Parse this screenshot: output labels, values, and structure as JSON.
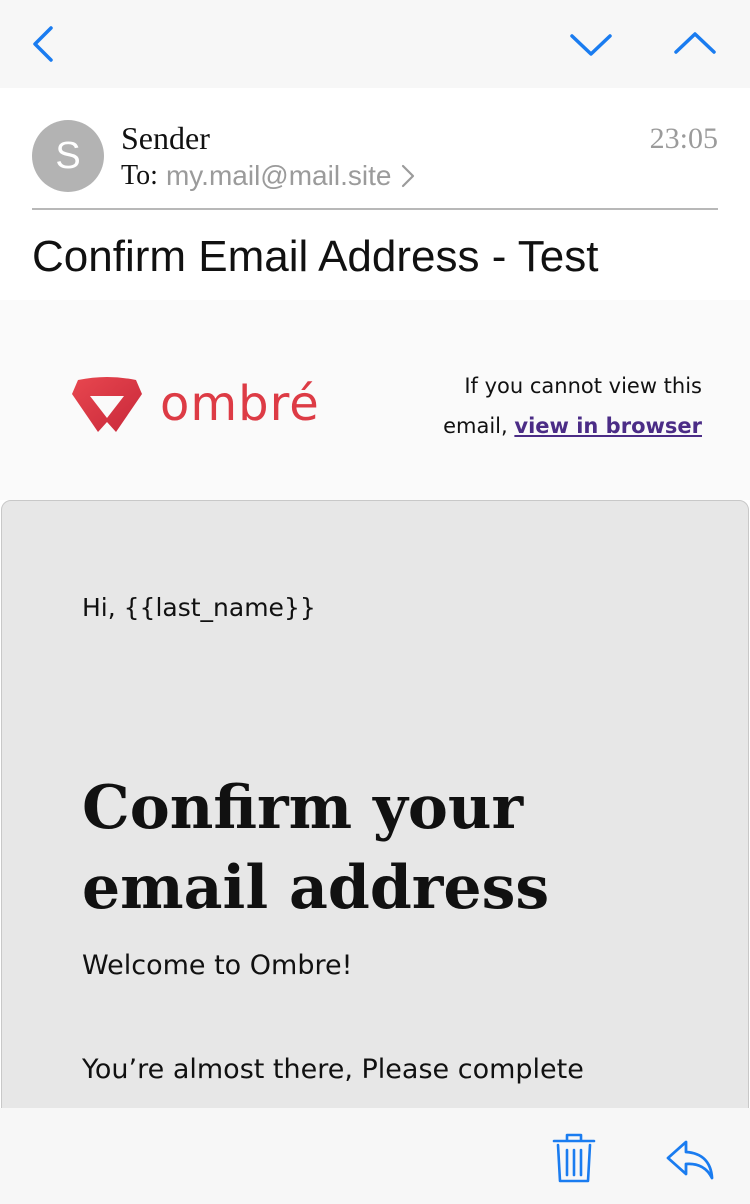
{
  "nav": {
    "back_icon": "chevron-left-icon",
    "down_icon": "chevron-down-icon",
    "up_icon": "chevron-up-icon",
    "accent_color": "#1a7cf0"
  },
  "message": {
    "avatar_initial": "S",
    "sender": "Sender",
    "to_label": "To:",
    "to_address": "my.mail@mail.site",
    "time": "23:05",
    "subject": "Confirm Email Address - Test"
  },
  "email": {
    "logo_text": "ombré",
    "brand_color": "#dd3b45",
    "view_note": "If you cannot view this email,",
    "view_link": "view in browser",
    "greeting": "Hi, {{last_name}}",
    "headline": "Confirm your email address",
    "welcome": "Welcome to Ombre!",
    "almost": "You’re almost there, Please complete"
  },
  "toolbar": {
    "trash_icon": "trash-icon",
    "reply_icon": "reply-icon"
  }
}
